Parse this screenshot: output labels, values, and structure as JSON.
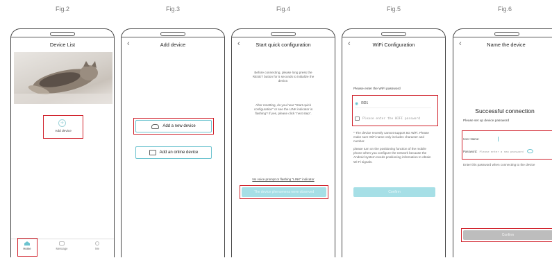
{
  "figs": [
    "Fig.2",
    "Fig.3",
    "Fig.4",
    "Fig.5",
    "Fig.6"
  ],
  "screen1": {
    "title": "Device List",
    "add_label": "Add device",
    "tabs": [
      "Home",
      "Message",
      "Me"
    ]
  },
  "screen2": {
    "title": "Add device",
    "add_new": "Add a new device",
    "add_online": "Add an online device"
  },
  "screen3": {
    "title": "Start quick configuration",
    "text1": "Before connecting, please long press the RESET button for 5 seconds to initialize the device.",
    "text2": "After resetting, do you hear \"Start quick configuration\" or see the LINK indicator is flashing? If yes, please click \"next step\".",
    "link": "No voice prompt or flashing \"LINK\" indicator",
    "button": "The device phenomena were observed"
  },
  "screen4": {
    "title": "WiFi Configuration",
    "prompt": "Please enter the WiFi password",
    "ssid": "RD1",
    "password_placeholder": "Please enter the WIFI password",
    "note1": "* The device recently cannot support 5G WiFi. Please make sure WiFi name only includes character and number.",
    "note2": "please turn on the positioning function of the mobile phone when you configure the network because the Android system needs positioning information to obtain Wi-Fi signals.",
    "button": "Confirm"
  },
  "screen5": {
    "title": "Name the device",
    "success": "Successful connection",
    "setup": "Please set up device password",
    "user_label": "User Name:",
    "pass_label": "Password:",
    "pass_placeholder": "Please enter a new password",
    "hint": "Enter this password when connecting to the device",
    "button": "Confirm"
  },
  "colors": {
    "highlight": "#d0202a",
    "accent": "#6cc3cf",
    "accent_fill": "#a6dfe6",
    "disabled": "#bdbdbd"
  }
}
